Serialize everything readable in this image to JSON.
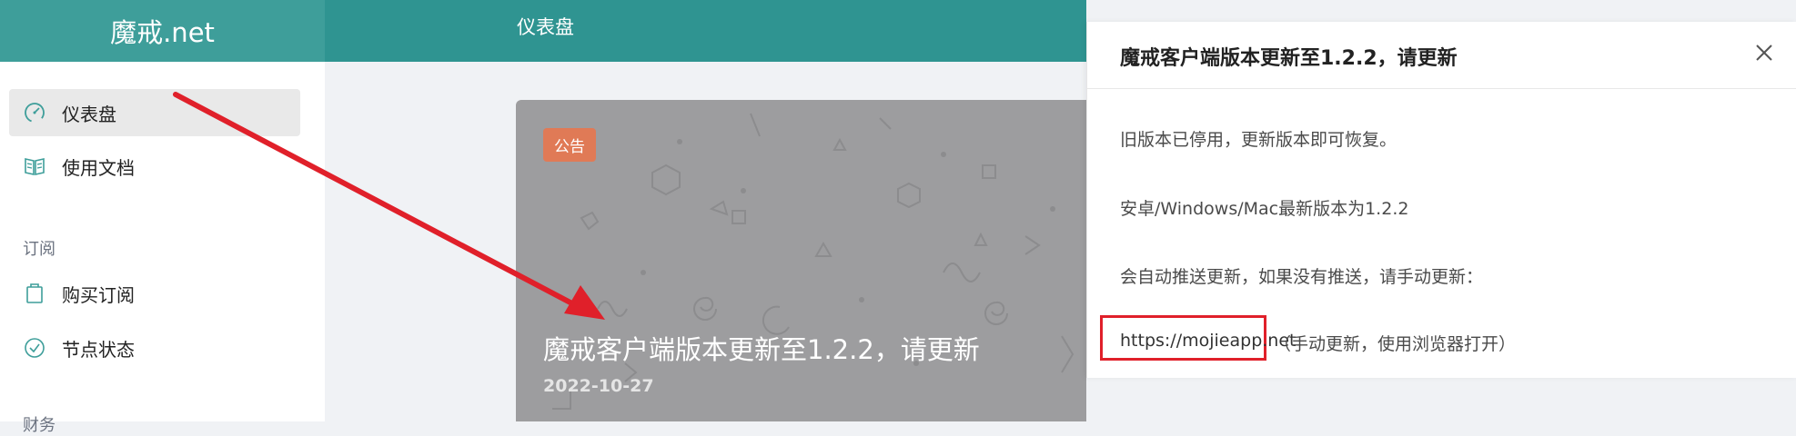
{
  "brand": {
    "name": "魔戒.net"
  },
  "topbar": {
    "title": "仪表盘"
  },
  "sidebar": {
    "items": [
      {
        "label": "仪表盘",
        "icon": "gauge-icon",
        "active": true
      },
      {
        "label": "使用文档",
        "icon": "book-icon"
      }
    ],
    "section_subscription": "订阅",
    "sub_items": [
      {
        "label": "购买订阅",
        "icon": "bag-icon"
      },
      {
        "label": "节点状态",
        "icon": "check-circle-icon"
      }
    ],
    "section_finance": "财务"
  },
  "card": {
    "badge": "公告",
    "headline": "魔戒客户端版本更新至1.2.2，请更新",
    "date": "2022-10-27"
  },
  "dialog": {
    "title": "魔戒客户端版本更新至1.2.2，请更新",
    "line1": "旧版本已停用，更新版本即可恢复。",
    "line2": "安卓/Windows/Mac最新版本为1.2.2",
    "line3": "会自动推送更新，如果没有推送，请手动更新：",
    "link": "https://mojieapp.net",
    "link_note": "（手动更新，使用浏览器打开）"
  },
  "colors": {
    "brand_bg": "#3e9e9a",
    "topbar_bg": "#2f9491",
    "badge": "#e07a56",
    "annotation_red": "#e0202a"
  }
}
